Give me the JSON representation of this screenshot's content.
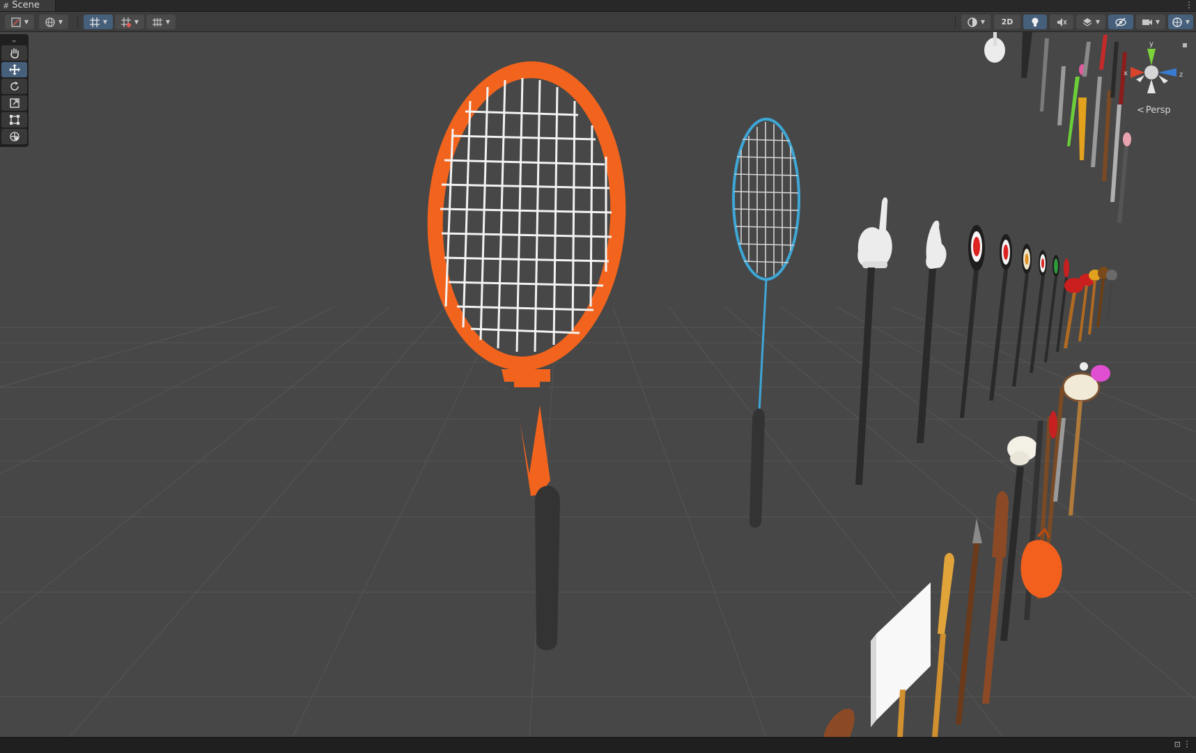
{
  "window": {
    "tab_title": "Scene",
    "tab_icon": "#"
  },
  "toolbar": {
    "view_2d_label": "2D",
    "accent_color": "#46607c",
    "left_buttons": [
      "draw-mode",
      "global-toggle",
      "grid-snap",
      "increment-snap",
      "grid-visibility"
    ],
    "right_buttons": [
      "shading-mode",
      "2d-toggle",
      "lighting-toggle",
      "audio-toggle",
      "effects",
      "scene-visibility",
      "camera-settings",
      "gizmos"
    ]
  },
  "tools": [
    {
      "name": "hand-tool",
      "active": false
    },
    {
      "name": "move-tool",
      "active": true
    },
    {
      "name": "rotate-tool",
      "active": false
    },
    {
      "name": "scale-tool",
      "active": false
    },
    {
      "name": "rect-tool",
      "active": false
    },
    {
      "name": "transform-tool",
      "active": false
    }
  ],
  "gizmo": {
    "projection_label": "Persp",
    "axes": {
      "x": "x",
      "y": "y",
      "z": "z"
    },
    "colors": {
      "x": "#d8432c",
      "y": "#7bd23a",
      "z": "#3a7bd2"
    }
  },
  "scene": {
    "background": "#474747",
    "objects": [
      "tennis-racket",
      "badminton-racket",
      "pointing-hand-stick",
      "thumb-hand-stick",
      "target-signs",
      "boxing-glove-sticks",
      "swords",
      "drum-stick",
      "mallet",
      "spear",
      "wooden-paddle",
      "oar",
      "picket-sign",
      "orange-sack"
    ]
  }
}
